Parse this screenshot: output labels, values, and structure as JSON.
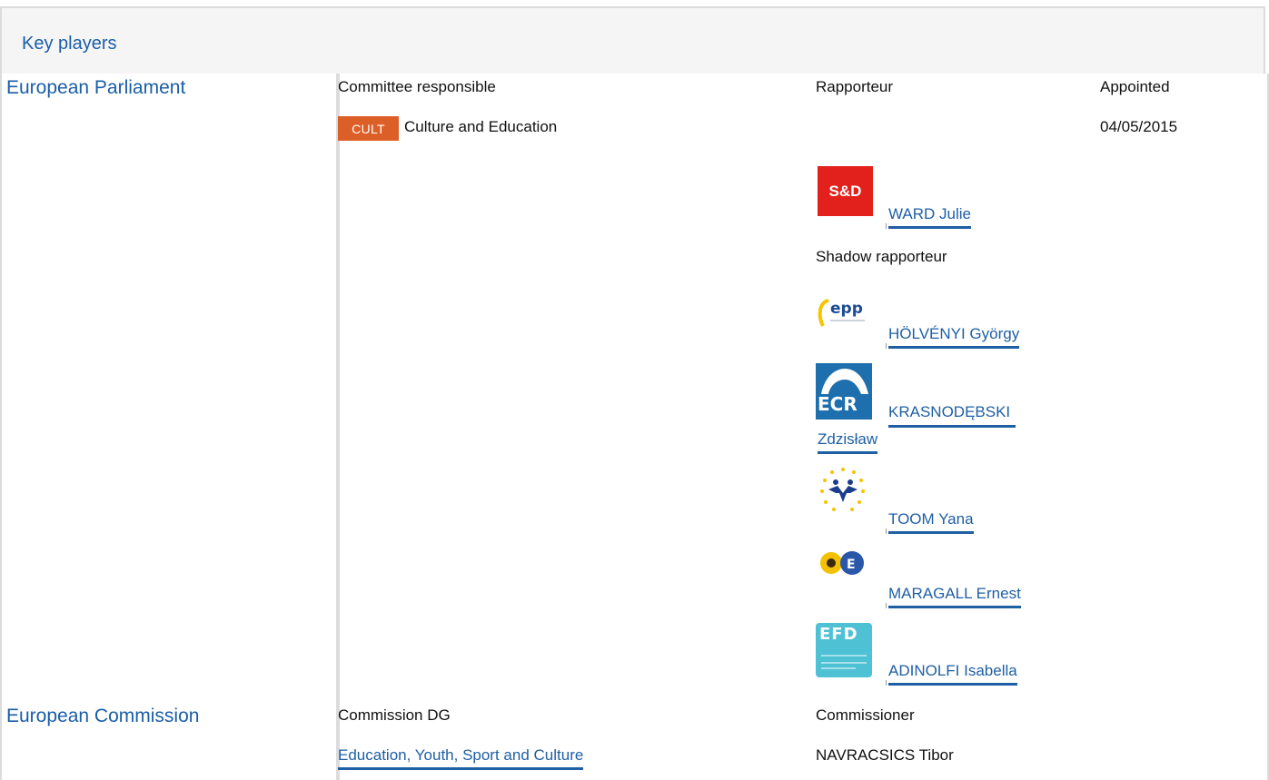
{
  "header": {
    "title": "Key players"
  },
  "parliament": {
    "title": "European Parliament",
    "col_committee": "Committee responsible",
    "col_rapporteur": "Rapporteur",
    "col_appointed": "Appointed",
    "committee_badge": "CULT",
    "committee_name": "Culture and Education",
    "appointed_date": "04/05/2015",
    "rapporteur": {
      "group_logo": "S&D",
      "name": "WARD Julie"
    },
    "shadow_label": "Shadow rapporteur",
    "shadows": [
      {
        "group_logo": "epp-logo",
        "name": "HÖLVÉNYI György"
      },
      {
        "group_logo": "ECR",
        "name_line1": "KRASNODĘBSKI",
        "name_line2": "Zdzisław"
      },
      {
        "group_logo": "enf-logo",
        "name": "TOOM Yana"
      },
      {
        "group_logo": "greens-efa-logo",
        "name": "MARAGALL Ernest"
      },
      {
        "group_logo": "EFD",
        "name": "ADINOLFI Isabella"
      }
    ]
  },
  "commission": {
    "title": "European Commission",
    "col_dg": "Commission DG",
    "col_commissioner": "Commissioner",
    "dg_name": "Education, Youth, Sport and Culture",
    "commissioner_name": "NAVRACSICS Tibor"
  },
  "colors": {
    "link_blue": "#1f5fa4",
    "badge_orange": "#dd5f28",
    "sd_red": "#e2211c",
    "ecr_blue": "#1e6fae",
    "efdd_teal": "#4ec1d4"
  }
}
